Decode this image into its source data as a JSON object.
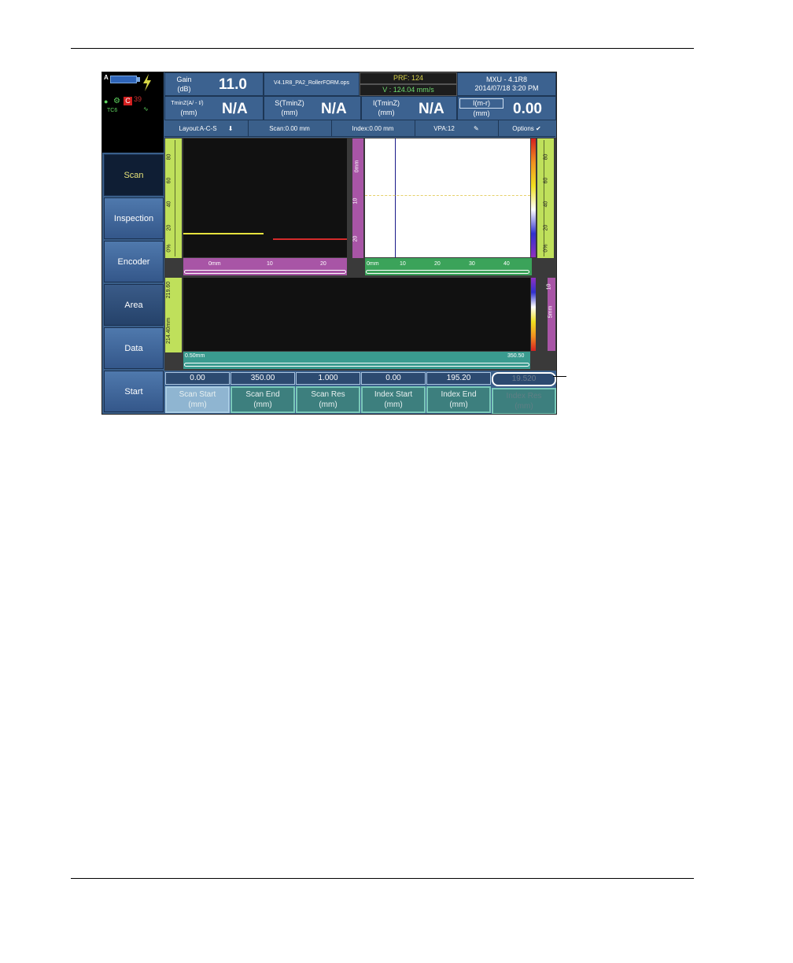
{
  "header": {
    "gain_label": "Gain",
    "gain_unit": "(dB)",
    "gain_value": "11.0",
    "file_name": "V4.1R8_PA2_RollerFORM.ops",
    "prf": "PRF: 124",
    "velocity": "V : 124.04 mm/s",
    "device": "MXU - 4.1R8",
    "datetime": "2014/07/18 3:20 PM",
    "reading1_label": "TminZ(A/ - I/)",
    "reading1_unit": "(mm)",
    "reading1_value": "N/A",
    "reading2_label": "S(TminZ)",
    "reading2_unit": "(mm)",
    "reading2_value": "N/A",
    "reading3_label": "I(TminZ)",
    "reading3_unit": "(mm)",
    "reading3_value": "N/A",
    "reading4_label": "I(m-r)",
    "reading4_unit": "(mm)",
    "reading4_value": "0.00",
    "status_channel": "A",
    "status_c": "C",
    "status_temp": "39",
    "status_tc": "TC6"
  },
  "toolbar": {
    "layout": "Layout:A-C-S",
    "scan": "Scan:0.00 mm",
    "index": "Index:0.00 mm",
    "vpa": "VPA:12",
    "options": "Options"
  },
  "tabs": [
    {
      "label": "Scan"
    },
    {
      "label": "Inspection"
    },
    {
      "label": "Encoder"
    },
    {
      "label": "Area"
    },
    {
      "label": "Data"
    },
    {
      "label": "Start"
    }
  ],
  "ascan": {
    "ruler_ticks": [
      "0%",
      "20",
      "40",
      "60",
      "80"
    ],
    "h_ticks": [
      "0mm",
      "10",
      "20"
    ]
  },
  "cscan": {
    "v_ticks": [
      "0mm",
      "10",
      "20"
    ],
    "h_ticks": [
      "0mm",
      "10",
      "20",
      "30",
      "40"
    ],
    "right_ticks": [
      "0%",
      "20",
      "40",
      "60",
      "80"
    ]
  },
  "sscan": {
    "left_top": "219.60",
    "left_bottom": "214.40mm",
    "right_top": "10",
    "right_mid": "5mm",
    "bottom_left": "0.50mm",
    "bottom_right": "350.50"
  },
  "params": [
    {
      "value": "0.00",
      "name": "Scan Start",
      "unit": "(mm)"
    },
    {
      "value": "350.00",
      "name": "Scan End",
      "unit": "(mm)"
    },
    {
      "value": "1.000",
      "name": "Scan Res",
      "unit": "(mm)"
    },
    {
      "value": "0.00",
      "name": "Index Start",
      "unit": "(mm)"
    },
    {
      "value": "195.20",
      "name": "Index End",
      "unit": "(mm)"
    },
    {
      "value": "19.520",
      "name": "Index Res",
      "unit": "(mm)"
    }
  ]
}
